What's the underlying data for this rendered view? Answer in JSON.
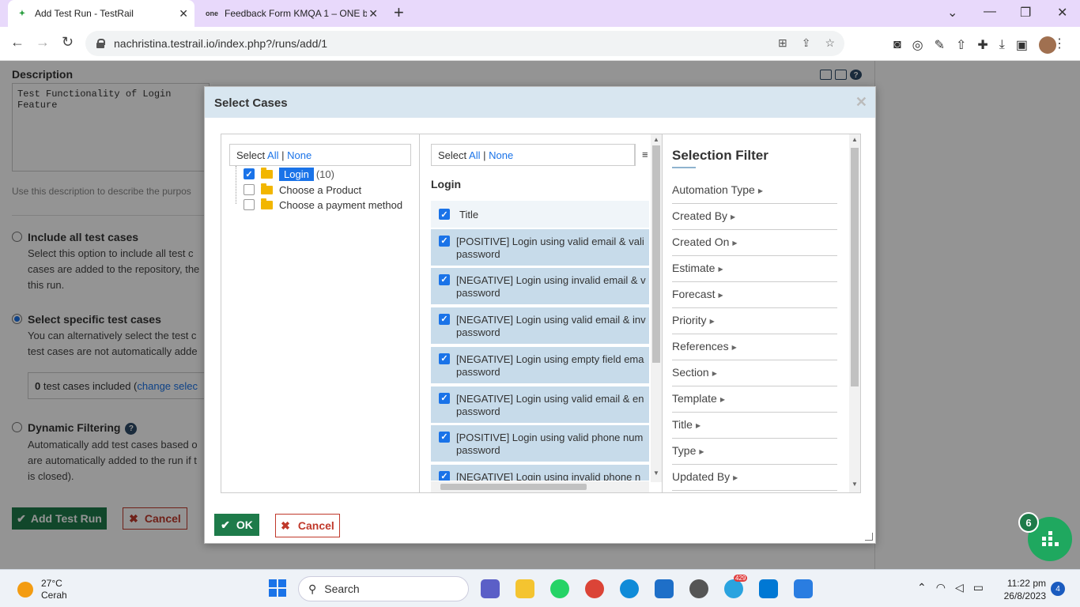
{
  "browser": {
    "tabs": [
      {
        "title": "Add Test Run - TestRail",
        "active": true
      },
      {
        "title": "Feedback Form KMQA 1 – ONE b",
        "active": false
      }
    ],
    "url": "nachristina.testrail.io/index.php?/runs/add/1"
  },
  "page": {
    "description_label": "Description",
    "description_value": "Test Functionality of Login Feature",
    "description_help": "Use this description to describe the purpos",
    "include_all": {
      "title": "Include all test cases",
      "text": [
        "Select this option to include all test c",
        "cases are added to the repository, the",
        "this run."
      ]
    },
    "select_specific": {
      "title": "Select specific test cases",
      "text": [
        "You can alternatively select the test c",
        "test cases are not automatically adde"
      ],
      "count": "0",
      "count_label": "test cases included (",
      "change_link": "change selec"
    },
    "dynamic": {
      "title": "Dynamic Filtering",
      "text": [
        "Automatically add test cases based o",
        "are automatically added to the run if t",
        "is closed)."
      ]
    },
    "add_button": "Add Test Run",
    "cancel_button": "Cancel"
  },
  "modal": {
    "title": "Select Cases",
    "tree": {
      "select": "Select",
      "all": "All",
      "sep": "|",
      "none": "None",
      "items": [
        {
          "label": "Login",
          "count": "(10)",
          "checked": true,
          "selected": true
        },
        {
          "label": "Choose a Product",
          "checked": false
        },
        {
          "label": "Choose a payment method",
          "checked": false
        }
      ]
    },
    "cases": {
      "select": "Select",
      "all": "All",
      "sep": "|",
      "none": "None",
      "section": "Login",
      "column_title": "Title",
      "rows": [
        {
          "line1": "[POSITIVE] Login using valid email & vali",
          "line2": "password"
        },
        {
          "line1": "[NEGATIVE] Login using invalid email & v",
          "line2": "password"
        },
        {
          "line1": "[NEGATIVE] Login using valid email & inv",
          "line2": "password"
        },
        {
          "line1": "[NEGATIVE] Login using empty field ema",
          "line2": "password"
        },
        {
          "line1": "[NEGATIVE] Login using valid email & en",
          "line2": "password"
        },
        {
          "line1": "[POSITIVE] Login using valid phone num",
          "line2": "password"
        },
        {
          "line1": "[NEGATIVE] Login using invalid phone n",
          "line2": ""
        }
      ]
    },
    "filter": {
      "title": "Selection Filter",
      "items": [
        "Automation Type",
        "Created By",
        "Created On",
        "Estimate",
        "Forecast",
        "Priority",
        "References",
        "Section",
        "Template",
        "Title",
        "Type",
        "Updated By"
      ]
    },
    "ok_button": "OK",
    "cancel_button": "Cancel"
  },
  "fab": {
    "badge": "6"
  },
  "taskbar": {
    "temp": "27°C",
    "weather": "Cerah",
    "search": "Search",
    "telegram_badge": "429",
    "time": "11:22 pm",
    "date": "26/8/2023",
    "notifications": "4"
  }
}
